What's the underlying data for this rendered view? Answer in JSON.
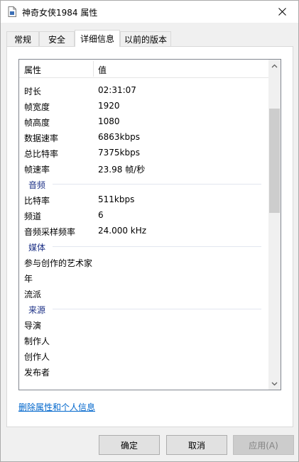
{
  "window": {
    "title": "神奇女侠1984 属性",
    "icon": "file-icon",
    "close_icon": "close-icon"
  },
  "tabs": [
    {
      "label": "常规"
    },
    {
      "label": "安全"
    },
    {
      "label": "详细信息",
      "active": true
    },
    {
      "label": "以前的版本"
    }
  ],
  "list": {
    "header_property": "属性",
    "header_value": "值",
    "rows": [
      {
        "type": "row",
        "key": "时长",
        "value": "02:31:07"
      },
      {
        "type": "row",
        "key": "帧宽度",
        "value": "1920"
      },
      {
        "type": "row",
        "key": "帧高度",
        "value": "1080"
      },
      {
        "type": "row",
        "key": "数据速率",
        "value": "6863kbps"
      },
      {
        "type": "row",
        "key": "总比特率",
        "value": "7375kbps"
      },
      {
        "type": "row",
        "key": "帧速率",
        "value": "23.98 帧/秒"
      },
      {
        "type": "group",
        "label": "音频"
      },
      {
        "type": "row",
        "key": "比特率",
        "value": "511kbps"
      },
      {
        "type": "row",
        "key": "频道",
        "value": "6"
      },
      {
        "type": "row",
        "key": "音频采样频率",
        "value": "24.000 kHz"
      },
      {
        "type": "group",
        "label": "媒体"
      },
      {
        "type": "row",
        "key": "参与创作的艺术家",
        "value": ""
      },
      {
        "type": "row",
        "key": "年",
        "value": ""
      },
      {
        "type": "row",
        "key": "流派",
        "value": ""
      },
      {
        "type": "group",
        "label": "来源"
      },
      {
        "type": "row",
        "key": "导演",
        "value": ""
      },
      {
        "type": "row",
        "key": "制作人",
        "value": ""
      },
      {
        "type": "row",
        "key": "创作人",
        "value": ""
      },
      {
        "type": "row",
        "key": "发布者",
        "value": ""
      }
    ]
  },
  "link_text": "删除属性和个人信息",
  "buttons": {
    "ok": "确定",
    "cancel": "取消",
    "apply": "应用(A)"
  },
  "colors": {
    "group_label": "#1e3287",
    "link": "#0066cc"
  }
}
